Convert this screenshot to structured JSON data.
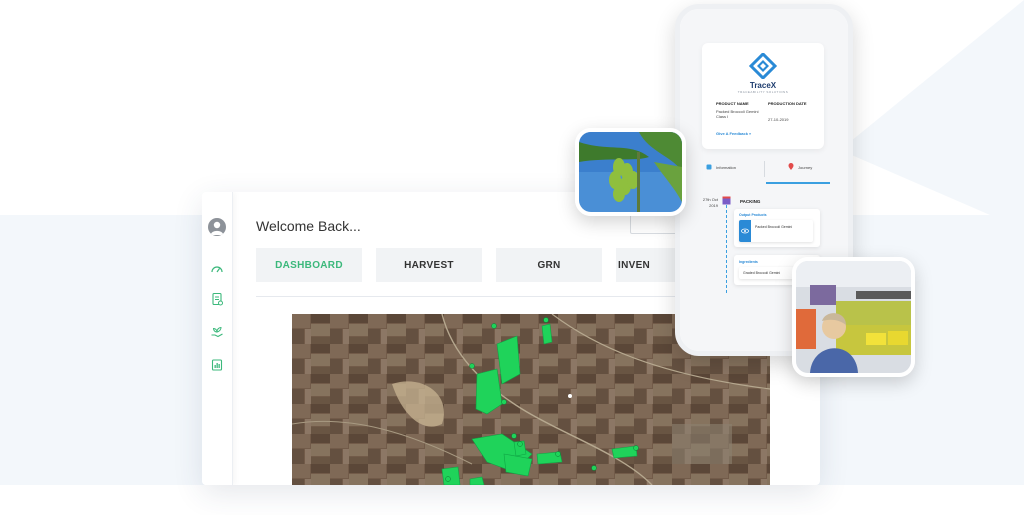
{
  "dashboard": {
    "welcome": "Welcome Back...",
    "tabs": [
      {
        "label": "DASHBOARD",
        "active": true
      },
      {
        "label": "HARVEST",
        "active": false
      },
      {
        "label": "GRN",
        "active": false
      },
      {
        "label": "INVEN",
        "active": false
      }
    ],
    "sidebar_icons": [
      "avatar",
      "speedometer-icon",
      "report-icon",
      "hand-plant-icon",
      "document-chart-icon"
    ]
  },
  "phone": {
    "brand": "TraceX",
    "brand_sub": "TRACEABILITY SOLUTIONS",
    "product_name_label": "PRODUCT NAME",
    "product_name": "Packed Broccoli Gemini Class I",
    "production_date_label": "PRODUCTION DATE",
    "production_date": "27-10-2019",
    "feedback_link": "Give A Feedback »",
    "tabs": [
      "Information",
      "Journey"
    ],
    "active_tab": "Journey",
    "timeline": {
      "date": "27th Oct 2019",
      "stage": "PACKING",
      "output_title": "Output Products",
      "output_item": "Packed Broccoli Gemini",
      "ingredients_title": "Ingredients",
      "ingredient_item": "Graded Broccoli Gemini"
    }
  },
  "colors": {
    "accent_green": "#3bb87b",
    "accent_blue": "#2a8ad6",
    "brand_navy": "#1d3c6e",
    "field_green": "#1fd35a"
  }
}
